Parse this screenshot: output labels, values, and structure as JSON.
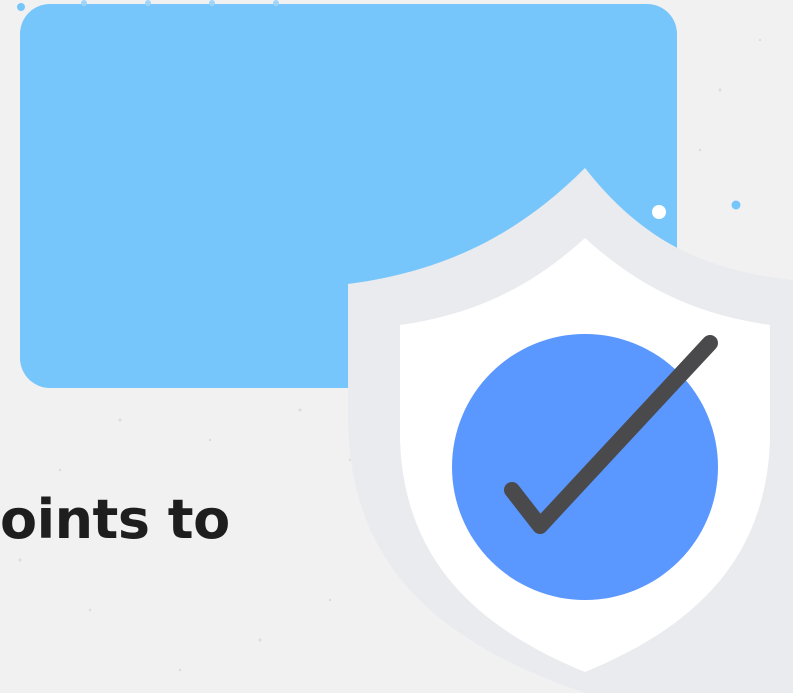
{
  "headline": {
    "text": "oints to"
  },
  "colors": {
    "background": "#f1f1f1",
    "panel": "#77c6fb",
    "shield_outer": "#e9ebee",
    "shield_inner": "#ffffff",
    "badge_circle": "#5a97ff",
    "checkmark": "#4a4a4c",
    "headline_text": "#1e1e1e"
  },
  "icons": {
    "shield": "shield-icon",
    "check": "checkmark-icon"
  }
}
